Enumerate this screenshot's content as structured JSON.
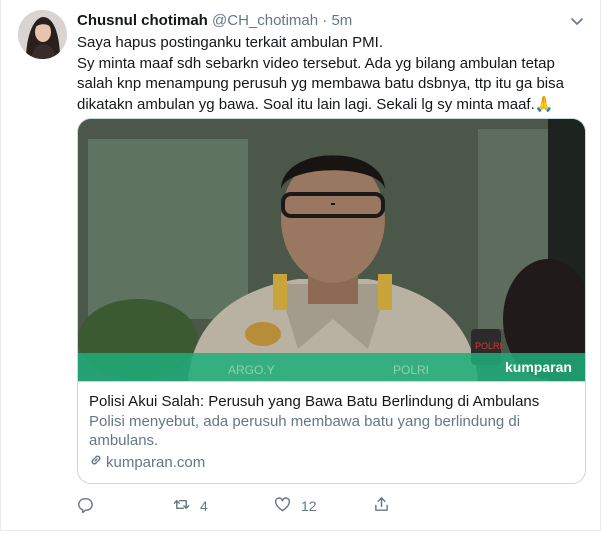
{
  "tweet": {
    "name": "Chusnul chotimah",
    "handle": "@CH_chotimah",
    "separator": "·",
    "time": "5m",
    "paragraph1": "Saya hapus postinganku terkait ambulan PMI.",
    "paragraph2": "Sy minta maaf sdh sebarkn video tersebut. Ada yg bilang ambulan tetap salah knp menampung perusuh yg membawa batu dsbnya, ttp itu ga bisa dikatakn ambulan yg bawa. Soal itu lain lagi. Sekali lg sy minta maaf.🙏"
  },
  "card": {
    "title": "Polisi Akui Salah: Perusuh yang Bawa Batu Berlindung di Ambulans",
    "description": "Polisi menyebut, ada perusuh membawa batu yang berlindung di ambulans.",
    "domain": "kumparan.com",
    "image_watermark": "kumparan",
    "image_banner_text_left": "ARGO.Y",
    "image_banner_text_right": "POLRI",
    "image_patch_text": "POLRI"
  },
  "actions": {
    "reply_count": "",
    "retweet_count": "4",
    "like_count": "12"
  },
  "colors": {
    "text": "#14171a",
    "muted": "#657786",
    "border": "#ccd6dd",
    "banner": "#1fae7a"
  },
  "icons": [
    "caret-down-icon",
    "link-icon",
    "reply-icon",
    "retweet-icon",
    "like-icon",
    "share-icon"
  ]
}
